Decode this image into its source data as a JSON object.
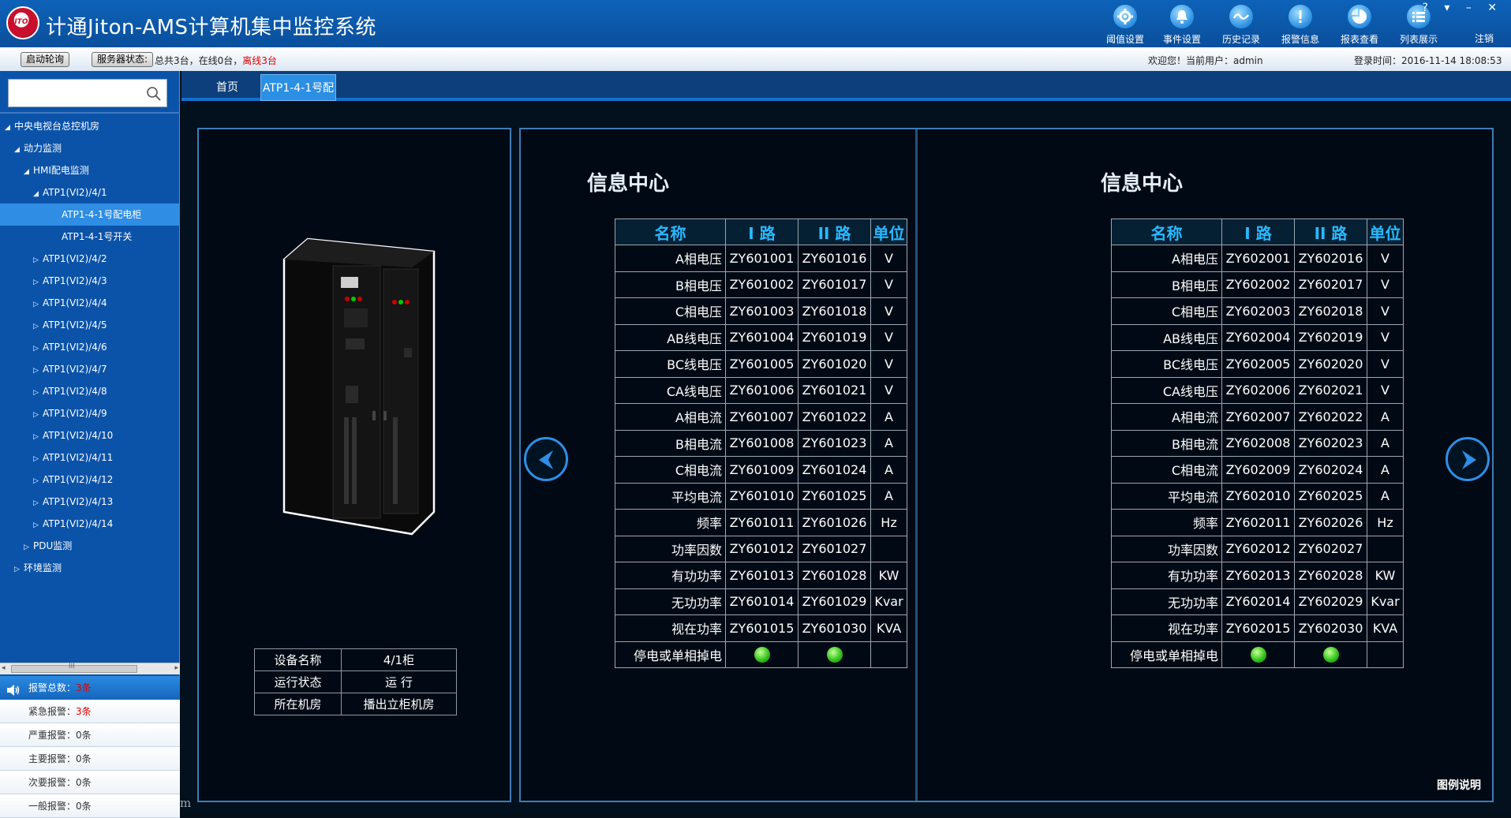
{
  "header": {
    "logo_text": "JITON",
    "title": "计通Jiton-AMS计算机集中监控系统",
    "tools": [
      {
        "label": "阈值设置",
        "icon": "gear-icon"
      },
      {
        "label": "事件设置",
        "icon": "bell-icon"
      },
      {
        "label": "历史记录",
        "icon": "wave-icon"
      },
      {
        "label": "报警信息",
        "icon": "alert-icon"
      },
      {
        "label": "报表查看",
        "icon": "pie-icon"
      },
      {
        "label": "列表展示",
        "icon": "list-icon"
      }
    ],
    "window_controls": "? ▾ – ✕",
    "logout": "注销"
  },
  "statusbar": {
    "poll_button": "启动轮询",
    "server_button": "服务器状态:",
    "summary_prefix": "总共3台，在线0台，",
    "summary_offline": "离线3台",
    "welcome": "欢迎您！当前用户：admin",
    "login_time": "登录时间：2016-11-14 18:08:53"
  },
  "sidebar": {
    "search_placeholder": "",
    "tree": [
      {
        "label": "中央电视台总控机房",
        "indent": 0,
        "arrow": "◢"
      },
      {
        "label": "动力监测",
        "indent": 1,
        "arrow": "◢"
      },
      {
        "label": "HMI配电监测",
        "indent": 2,
        "arrow": "◢"
      },
      {
        "label": "ATP1(VI2)/4/1",
        "indent": 3,
        "arrow": "◢"
      },
      {
        "label": "ATP1-4-1号配电柜",
        "indent": 5,
        "arrow": "",
        "selected": true
      },
      {
        "label": "ATP1-4-1号开关",
        "indent": 5,
        "arrow": ""
      },
      {
        "label": "ATP1(VI2)/4/2",
        "indent": 3,
        "arrow": "▷"
      },
      {
        "label": "ATP1(VI2)/4/3",
        "indent": 3,
        "arrow": "▷"
      },
      {
        "label": "ATP1(VI2)/4/4",
        "indent": 3,
        "arrow": "▷"
      },
      {
        "label": "ATP1(VI2)/4/5",
        "indent": 3,
        "arrow": "▷"
      },
      {
        "label": "ATP1(VI2)/4/6",
        "indent": 3,
        "arrow": "▷"
      },
      {
        "label": "ATP1(VI2)/4/7",
        "indent": 3,
        "arrow": "▷"
      },
      {
        "label": "ATP1(VI2)/4/8",
        "indent": 3,
        "arrow": "▷"
      },
      {
        "label": "ATP1(VI2)/4/9",
        "indent": 3,
        "arrow": "▷"
      },
      {
        "label": "ATP1(VI2)/4/10",
        "indent": 3,
        "arrow": "▷"
      },
      {
        "label": "ATP1(VI2)/4/11",
        "indent": 3,
        "arrow": "▷"
      },
      {
        "label": "ATP1(VI2)/4/12",
        "indent": 3,
        "arrow": "▷"
      },
      {
        "label": "ATP1(VI2)/4/13",
        "indent": 3,
        "arrow": "▷"
      },
      {
        "label": "ATP1(VI2)/4/14",
        "indent": 3,
        "arrow": "▷"
      },
      {
        "label": "PDU监测",
        "indent": 2,
        "arrow": "▷"
      },
      {
        "label": "环境监测",
        "indent": 1,
        "arrow": "▷"
      }
    ],
    "scroll_thumb_text": "III"
  },
  "alarms": {
    "total_label": "报警总数：",
    "total_value": "3条",
    "rows": [
      {
        "label": "紧急报警：",
        "value": "3条",
        "red": true
      },
      {
        "label": "严重报警：",
        "value": "0条",
        "red": false
      },
      {
        "label": "主要报警：",
        "value": "0条",
        "red": false
      },
      {
        "label": "次要报警：",
        "value": "0条",
        "red": false
      },
      {
        "label": "一般报警：",
        "value": "0条",
        "red": false
      }
    ]
  },
  "tabs": {
    "home": "首页",
    "device": "ATP1-4-1号配"
  },
  "device": {
    "rows": [
      {
        "label": "设备名称",
        "value": "4/1柜"
      },
      {
        "label": "运行状态",
        "value": "运 行"
      },
      {
        "label": "所在机房",
        "value": "播出立柜机房"
      }
    ]
  },
  "info_panels": [
    {
      "title": "信息中心",
      "headers": [
        "名称",
        "I 路",
        "II 路",
        "单位"
      ],
      "rows": [
        [
          "A相电压",
          "ZY601001",
          "ZY601016",
          "V"
        ],
        [
          "B相电压",
          "ZY601002",
          "ZY601017",
          "V"
        ],
        [
          "C相电压",
          "ZY601003",
          "ZY601018",
          "V"
        ],
        [
          "AB线电压",
          "ZY601004",
          "ZY601019",
          "V"
        ],
        [
          "BC线电压",
          "ZY601005",
          "ZY601020",
          "V"
        ],
        [
          "CA线电压",
          "ZY601006",
          "ZY601021",
          "V"
        ],
        [
          "A相电流",
          "ZY601007",
          "ZY601022",
          "A"
        ],
        [
          "B相电流",
          "ZY601008",
          "ZY601023",
          "A"
        ],
        [
          "C相电流",
          "ZY601009",
          "ZY601024",
          "A"
        ],
        [
          "平均电流",
          "ZY601010",
          "ZY601025",
          "A"
        ],
        [
          "频率",
          "ZY601011",
          "ZY601026",
          "Hz"
        ],
        [
          "功率因数",
          "ZY601012",
          "ZY601027",
          ""
        ],
        [
          "有功功率",
          "ZY601013",
          "ZY601028",
          "KW"
        ],
        [
          "无功功率",
          "ZY601014",
          "ZY601029",
          "Kvar"
        ],
        [
          "视在功率",
          "ZY601015",
          "ZY601030",
          "KVA"
        ]
      ],
      "status_row_label": "停电或单相掉电"
    },
    {
      "title": "信息中心",
      "headers": [
        "名称",
        "I 路",
        "II 路",
        "单位"
      ],
      "rows": [
        [
          "A相电压",
          "ZY602001",
          "ZY602016",
          "V"
        ],
        [
          "B相电压",
          "ZY602002",
          "ZY602017",
          "V"
        ],
        [
          "C相电压",
          "ZY602003",
          "ZY602018",
          "V"
        ],
        [
          "AB线电压",
          "ZY602004",
          "ZY602019",
          "V"
        ],
        [
          "BC线电压",
          "ZY602005",
          "ZY602020",
          "V"
        ],
        [
          "CA线电压",
          "ZY602006",
          "ZY602021",
          "V"
        ],
        [
          "A相电流",
          "ZY602007",
          "ZY602022",
          "A"
        ],
        [
          "B相电流",
          "ZY602008",
          "ZY602023",
          "A"
        ],
        [
          "C相电流",
          "ZY602009",
          "ZY602024",
          "A"
        ],
        [
          "平均电流",
          "ZY602010",
          "ZY602025",
          "A"
        ],
        [
          "频率",
          "ZY602011",
          "ZY602026",
          "Hz"
        ],
        [
          "功率因数",
          "ZY602012",
          "ZY602027",
          ""
        ],
        [
          "有功功率",
          "ZY602013",
          "ZY602028",
          "KW"
        ],
        [
          "无功功率",
          "ZY602014",
          "ZY602029",
          "Kvar"
        ],
        [
          "视在功率",
          "ZY602015",
          "ZY602030",
          "KVA"
        ]
      ],
      "status_row_label": "停电或单相掉电"
    }
  ],
  "legend": "图例说明",
  "watermark": "m",
  "colors": {
    "header_blue": "#0d62b8",
    "sidebar_blue": "#0b53a9",
    "selected_blue": "#2f8de4",
    "table_header_cyan": "#29b9ff",
    "panel_border": "#3f7cb8",
    "alarm_red": "#e00000",
    "led_green": "#34c51c"
  }
}
